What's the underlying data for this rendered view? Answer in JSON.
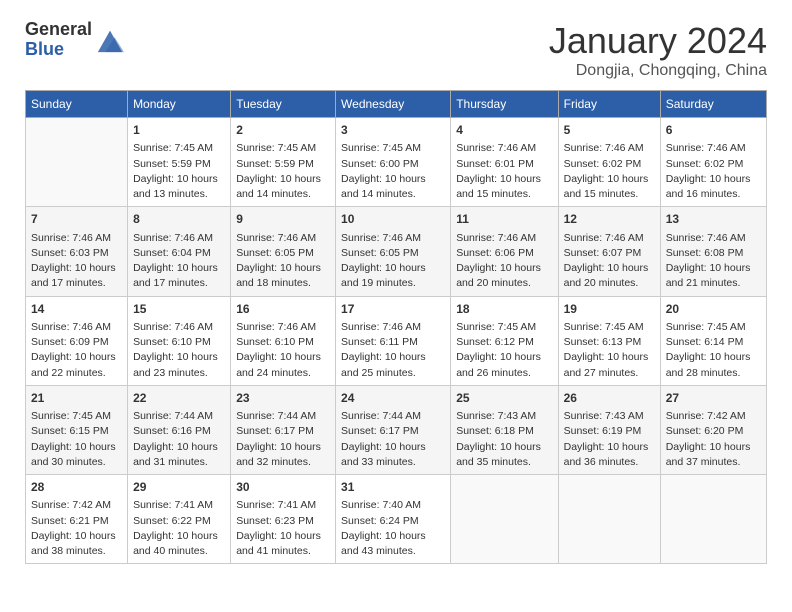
{
  "header": {
    "logo_general": "General",
    "logo_blue": "Blue",
    "month_title": "January 2024",
    "location": "Dongjia, Chongqing, China"
  },
  "days_of_week": [
    "Sunday",
    "Monday",
    "Tuesday",
    "Wednesday",
    "Thursday",
    "Friday",
    "Saturday"
  ],
  "weeks": [
    [
      {
        "day": "",
        "sunrise": "",
        "sunset": "",
        "daylight": ""
      },
      {
        "day": "1",
        "sunrise": "Sunrise: 7:45 AM",
        "sunset": "Sunset: 5:59 PM",
        "daylight": "Daylight: 10 hours and 13 minutes."
      },
      {
        "day": "2",
        "sunrise": "Sunrise: 7:45 AM",
        "sunset": "Sunset: 5:59 PM",
        "daylight": "Daylight: 10 hours and 14 minutes."
      },
      {
        "day": "3",
        "sunrise": "Sunrise: 7:45 AM",
        "sunset": "Sunset: 6:00 PM",
        "daylight": "Daylight: 10 hours and 14 minutes."
      },
      {
        "day": "4",
        "sunrise": "Sunrise: 7:46 AM",
        "sunset": "Sunset: 6:01 PM",
        "daylight": "Daylight: 10 hours and 15 minutes."
      },
      {
        "day": "5",
        "sunrise": "Sunrise: 7:46 AM",
        "sunset": "Sunset: 6:02 PM",
        "daylight": "Daylight: 10 hours and 15 minutes."
      },
      {
        "day": "6",
        "sunrise": "Sunrise: 7:46 AM",
        "sunset": "Sunset: 6:02 PM",
        "daylight": "Daylight: 10 hours and 16 minutes."
      }
    ],
    [
      {
        "day": "7",
        "sunrise": "Sunrise: 7:46 AM",
        "sunset": "Sunset: 6:03 PM",
        "daylight": "Daylight: 10 hours and 17 minutes."
      },
      {
        "day": "8",
        "sunrise": "Sunrise: 7:46 AM",
        "sunset": "Sunset: 6:04 PM",
        "daylight": "Daylight: 10 hours and 17 minutes."
      },
      {
        "day": "9",
        "sunrise": "Sunrise: 7:46 AM",
        "sunset": "Sunset: 6:05 PM",
        "daylight": "Daylight: 10 hours and 18 minutes."
      },
      {
        "day": "10",
        "sunrise": "Sunrise: 7:46 AM",
        "sunset": "Sunset: 6:05 PM",
        "daylight": "Daylight: 10 hours and 19 minutes."
      },
      {
        "day": "11",
        "sunrise": "Sunrise: 7:46 AM",
        "sunset": "Sunset: 6:06 PM",
        "daylight": "Daylight: 10 hours and 20 minutes."
      },
      {
        "day": "12",
        "sunrise": "Sunrise: 7:46 AM",
        "sunset": "Sunset: 6:07 PM",
        "daylight": "Daylight: 10 hours and 20 minutes."
      },
      {
        "day": "13",
        "sunrise": "Sunrise: 7:46 AM",
        "sunset": "Sunset: 6:08 PM",
        "daylight": "Daylight: 10 hours and 21 minutes."
      }
    ],
    [
      {
        "day": "14",
        "sunrise": "Sunrise: 7:46 AM",
        "sunset": "Sunset: 6:09 PM",
        "daylight": "Daylight: 10 hours and 22 minutes."
      },
      {
        "day": "15",
        "sunrise": "Sunrise: 7:46 AM",
        "sunset": "Sunset: 6:10 PM",
        "daylight": "Daylight: 10 hours and 23 minutes."
      },
      {
        "day": "16",
        "sunrise": "Sunrise: 7:46 AM",
        "sunset": "Sunset: 6:10 PM",
        "daylight": "Daylight: 10 hours and 24 minutes."
      },
      {
        "day": "17",
        "sunrise": "Sunrise: 7:46 AM",
        "sunset": "Sunset: 6:11 PM",
        "daylight": "Daylight: 10 hours and 25 minutes."
      },
      {
        "day": "18",
        "sunrise": "Sunrise: 7:45 AM",
        "sunset": "Sunset: 6:12 PM",
        "daylight": "Daylight: 10 hours and 26 minutes."
      },
      {
        "day": "19",
        "sunrise": "Sunrise: 7:45 AM",
        "sunset": "Sunset: 6:13 PM",
        "daylight": "Daylight: 10 hours and 27 minutes."
      },
      {
        "day": "20",
        "sunrise": "Sunrise: 7:45 AM",
        "sunset": "Sunset: 6:14 PM",
        "daylight": "Daylight: 10 hours and 28 minutes."
      }
    ],
    [
      {
        "day": "21",
        "sunrise": "Sunrise: 7:45 AM",
        "sunset": "Sunset: 6:15 PM",
        "daylight": "Daylight: 10 hours and 30 minutes."
      },
      {
        "day": "22",
        "sunrise": "Sunrise: 7:44 AM",
        "sunset": "Sunset: 6:16 PM",
        "daylight": "Daylight: 10 hours and 31 minutes."
      },
      {
        "day": "23",
        "sunrise": "Sunrise: 7:44 AM",
        "sunset": "Sunset: 6:17 PM",
        "daylight": "Daylight: 10 hours and 32 minutes."
      },
      {
        "day": "24",
        "sunrise": "Sunrise: 7:44 AM",
        "sunset": "Sunset: 6:17 PM",
        "daylight": "Daylight: 10 hours and 33 minutes."
      },
      {
        "day": "25",
        "sunrise": "Sunrise: 7:43 AM",
        "sunset": "Sunset: 6:18 PM",
        "daylight": "Daylight: 10 hours and 35 minutes."
      },
      {
        "day": "26",
        "sunrise": "Sunrise: 7:43 AM",
        "sunset": "Sunset: 6:19 PM",
        "daylight": "Daylight: 10 hours and 36 minutes."
      },
      {
        "day": "27",
        "sunrise": "Sunrise: 7:42 AM",
        "sunset": "Sunset: 6:20 PM",
        "daylight": "Daylight: 10 hours and 37 minutes."
      }
    ],
    [
      {
        "day": "28",
        "sunrise": "Sunrise: 7:42 AM",
        "sunset": "Sunset: 6:21 PM",
        "daylight": "Daylight: 10 hours and 38 minutes."
      },
      {
        "day": "29",
        "sunrise": "Sunrise: 7:41 AM",
        "sunset": "Sunset: 6:22 PM",
        "daylight": "Daylight: 10 hours and 40 minutes."
      },
      {
        "day": "30",
        "sunrise": "Sunrise: 7:41 AM",
        "sunset": "Sunset: 6:23 PM",
        "daylight": "Daylight: 10 hours and 41 minutes."
      },
      {
        "day": "31",
        "sunrise": "Sunrise: 7:40 AM",
        "sunset": "Sunset: 6:24 PM",
        "daylight": "Daylight: 10 hours and 43 minutes."
      },
      {
        "day": "",
        "sunrise": "",
        "sunset": "",
        "daylight": ""
      },
      {
        "day": "",
        "sunrise": "",
        "sunset": "",
        "daylight": ""
      },
      {
        "day": "",
        "sunrise": "",
        "sunset": "",
        "daylight": ""
      }
    ]
  ]
}
